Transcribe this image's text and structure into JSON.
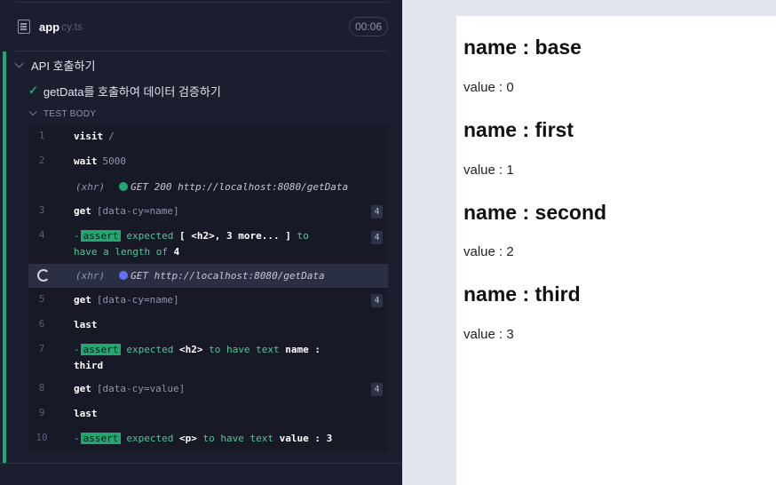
{
  "spec": {
    "name": "app",
    "ext": "cy.ts",
    "duration": "00:06",
    "icon": "document-icon"
  },
  "suite": {
    "title": "API 호출하기"
  },
  "test": {
    "title": "getData를 호출하여 데이터 검증하기",
    "status_icon": "check-icon"
  },
  "test_body_label": "TEST BODY",
  "commands": [
    {
      "num": "1",
      "name": "visit",
      "msg": "/"
    },
    {
      "num": "2",
      "name": "wait",
      "msg": "5000"
    },
    {
      "xhr": "(xhr)",
      "text": "GET 200 http://localhost:8080/getData",
      "status_color": "#1fa971"
    },
    {
      "num": "3",
      "name": "get",
      "msg": "[data-cy=name]",
      "badge": "4"
    },
    {
      "num": "4",
      "assert": "assert",
      "line1_a": "expected",
      "line1_b": "[ <h2>, 3 more... ]",
      "line1_c": "to",
      "line2_a": "have a length of",
      "line2_b": "4",
      "badge": "4"
    },
    {
      "xhr": "(xhr)",
      "text": "GET http://localhost:8080/getData",
      "status_color": "#6470f3"
    },
    {
      "num": "5",
      "name": "get",
      "msg": "[data-cy=name]",
      "badge": "4"
    },
    {
      "num": "6",
      "name": "last"
    },
    {
      "num": "7",
      "assert": "assert",
      "line1_a": "expected",
      "line1_b": "<h2>",
      "line1_c": "to have text",
      "line1_d": "name :",
      "line2_b": "third"
    },
    {
      "num": "8",
      "name": "get",
      "msg": "[data-cy=value]",
      "badge": "4"
    },
    {
      "num": "9",
      "name": "last"
    },
    {
      "num": "10",
      "assert": "assert",
      "line1_a": "expected",
      "line1_b": "<p>",
      "line1_c": "to have text",
      "line1_d": "value : 3"
    }
  ],
  "dash": "-",
  "preview_items": [
    {
      "name": "name : base",
      "value": "value : 0"
    },
    {
      "name": "name : first",
      "value": "value : 1"
    },
    {
      "name": "name : second",
      "value": "value : 2"
    },
    {
      "name": "name : third",
      "value": "value : 3"
    }
  ]
}
